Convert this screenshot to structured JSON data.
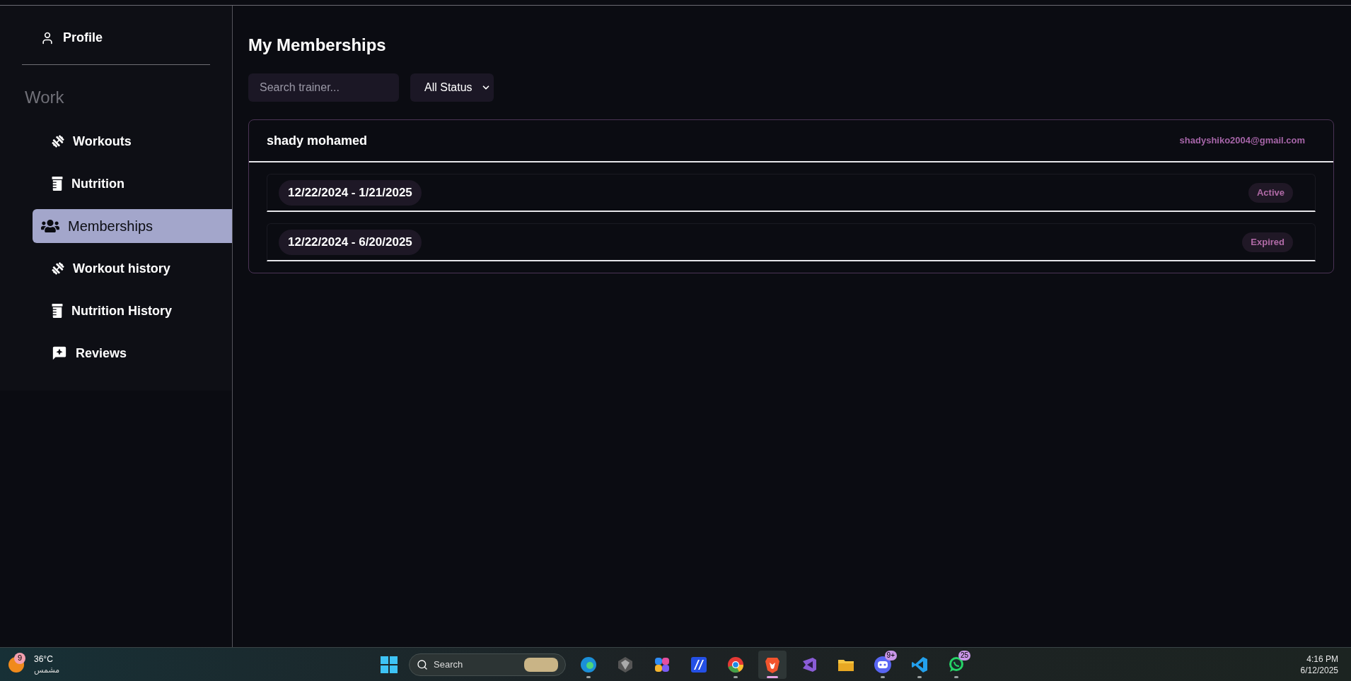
{
  "sidebar": {
    "profile": {
      "label": "Profile"
    },
    "section": "Work",
    "items": [
      {
        "label": "Workouts",
        "kind": "dumbbell",
        "selected": false
      },
      {
        "label": "Nutrition",
        "kind": "bottle",
        "selected": false
      },
      {
        "label": "Memberships",
        "kind": "users",
        "selected": true
      },
      {
        "label": "Workout history",
        "kind": "dumbbell",
        "selected": false
      },
      {
        "label": "Nutrition History",
        "kind": "bottle",
        "selected": false
      },
      {
        "label": "Reviews",
        "kind": "review",
        "selected": false
      }
    ]
  },
  "main": {
    "title": "My Memberships",
    "search": {
      "placeholder": "Search trainer..."
    },
    "status_filter": {
      "value": "All Status"
    },
    "trainers": [
      {
        "name": "shady mohamed",
        "email": "shadyshiko2004@gmail.com",
        "memberships": [
          {
            "dates": "12/22/2024 - 1/21/2025",
            "status": "Active"
          },
          {
            "dates": "12/22/2024 - 6/20/2025",
            "status": "Expired"
          }
        ]
      }
    ]
  },
  "taskbar": {
    "weather": {
      "badge": "9",
      "temperature": "36°C",
      "condition": "مشمس"
    },
    "search": {
      "placeholder": "Search"
    },
    "apps": [
      {
        "kind": "edge",
        "selected": false,
        "running": true
      },
      {
        "kind": "hexagon",
        "selected": false,
        "running": false
      },
      {
        "kind": "copilot",
        "selected": false,
        "running": false
      },
      {
        "kind": "tile",
        "selected": false,
        "running": false
      },
      {
        "kind": "chrome",
        "selected": false,
        "running": true
      },
      {
        "kind": "brave",
        "selected": true,
        "running": true
      },
      {
        "kind": "studio",
        "selected": false,
        "running": false
      },
      {
        "kind": "folder",
        "selected": false,
        "running": false
      },
      {
        "kind": "discord",
        "selected": false,
        "running": true,
        "badge": "9+"
      },
      {
        "kind": "vscode",
        "selected": false,
        "running": true
      },
      {
        "kind": "whatsapp",
        "selected": false,
        "running": true,
        "badge": "25"
      }
    ],
    "time": "4:16 PM",
    "date": "6/12/2025"
  }
}
